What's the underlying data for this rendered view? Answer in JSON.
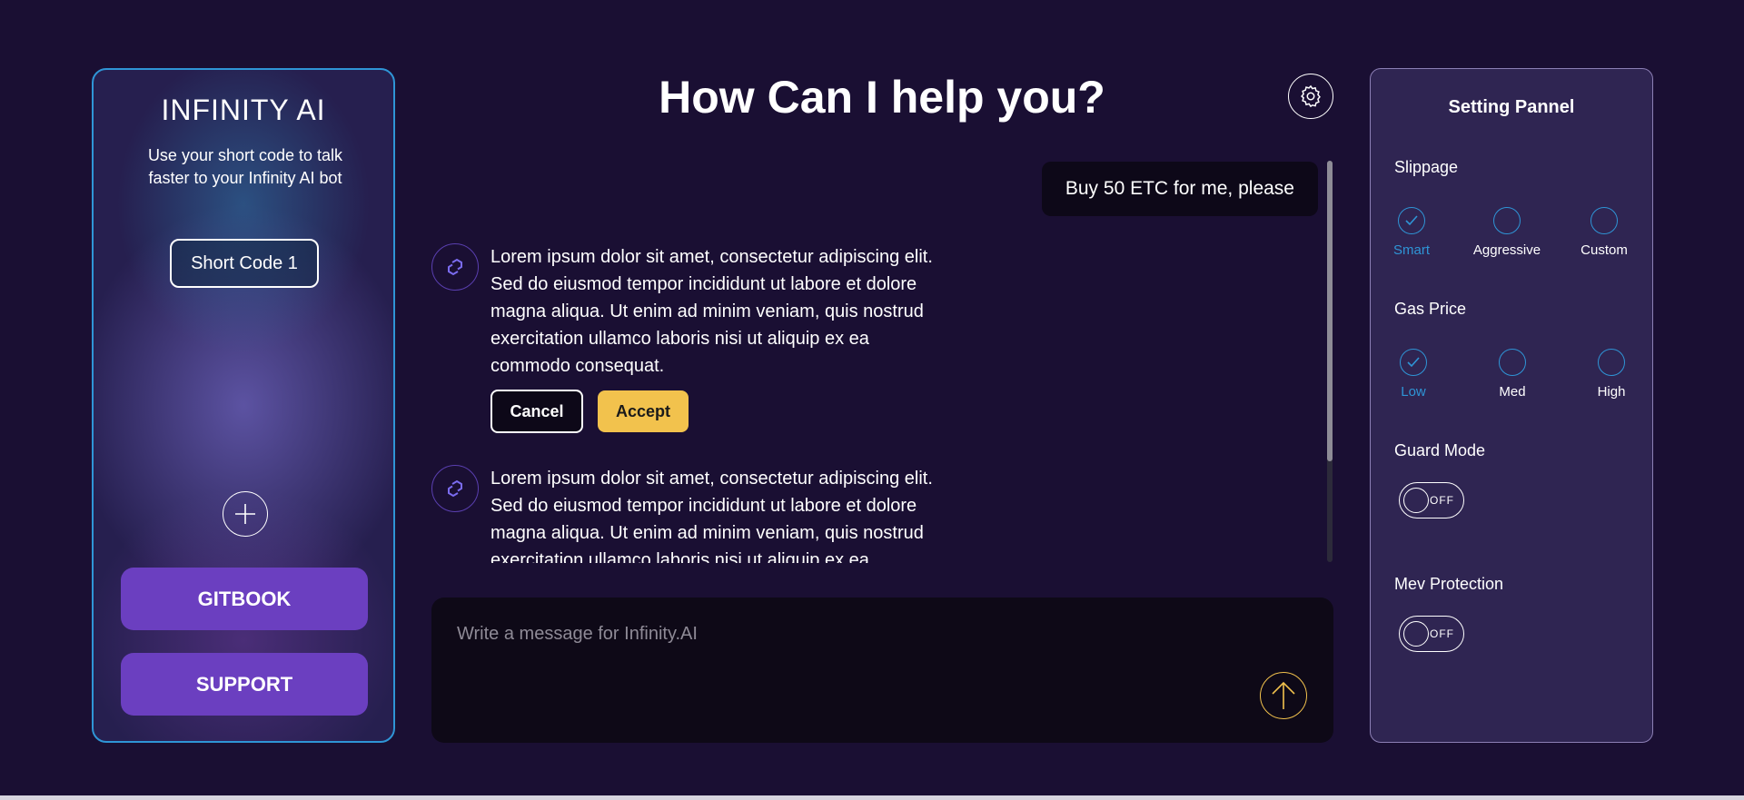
{
  "left_panel": {
    "logo": "INFINITY AI",
    "tagline": "Use your short code to talk faster to your Infinity AI bot",
    "short_code_label": "Short Code 1",
    "gitbook_label": "GITBOOK",
    "support_label": "SUPPORT"
  },
  "header": {
    "title": "How Can I help you?"
  },
  "chat": {
    "user_message": "Buy 50 ETC for me, please",
    "bot_messages": [
      {
        "text": "Lorem ipsum dolor sit amet, consectetur adipiscing elit. Sed do eiusmod tempor incididunt ut labore et dolore magna aliqua. Ut enim ad minim veniam, quis nostrud exercitation ullamco laboris nisi ut aliquip ex ea commodo consequat.",
        "cancel_label": "Cancel",
        "accept_label": "Accept"
      },
      {
        "text": "Lorem ipsum dolor sit amet, consectetur adipiscing elit. Sed do eiusmod tempor incididunt ut labore et dolore magna aliqua. Ut enim ad minim veniam, quis nostrud exercitation ullamco laboris nisi ut aliquip ex ea commodo consequat."
      }
    ],
    "scroll_position": 0.0
  },
  "composer": {
    "placeholder": "Write a message for Infinity.AI",
    "value": ""
  },
  "settings_panel": {
    "title": "Setting Pannel",
    "slippage": {
      "label": "Slippage",
      "options": [
        "Smart",
        "Aggressive",
        "Custom"
      ],
      "selected": "Smart"
    },
    "gas_price": {
      "label": "Gas Price",
      "options": [
        "Low",
        "Med",
        "High"
      ],
      "selected": "Low"
    },
    "guard_mode": {
      "label": "Guard Mode",
      "state": "OFF"
    },
    "mev_protection": {
      "label": "Mev Protection",
      "state": "OFF"
    }
  },
  "colors": {
    "background": "#1a0f33",
    "accent_blue": "#2f95d6",
    "accent_yellow": "#f2c24d",
    "button_purple": "#6b3fc0",
    "panel_purple": "#2f2552"
  },
  "icons": {
    "settings": "gear-icon",
    "add": "plus-icon",
    "send": "arrow-up-icon",
    "bot": "link-chain-icon",
    "selected": "checkmark-icon"
  }
}
